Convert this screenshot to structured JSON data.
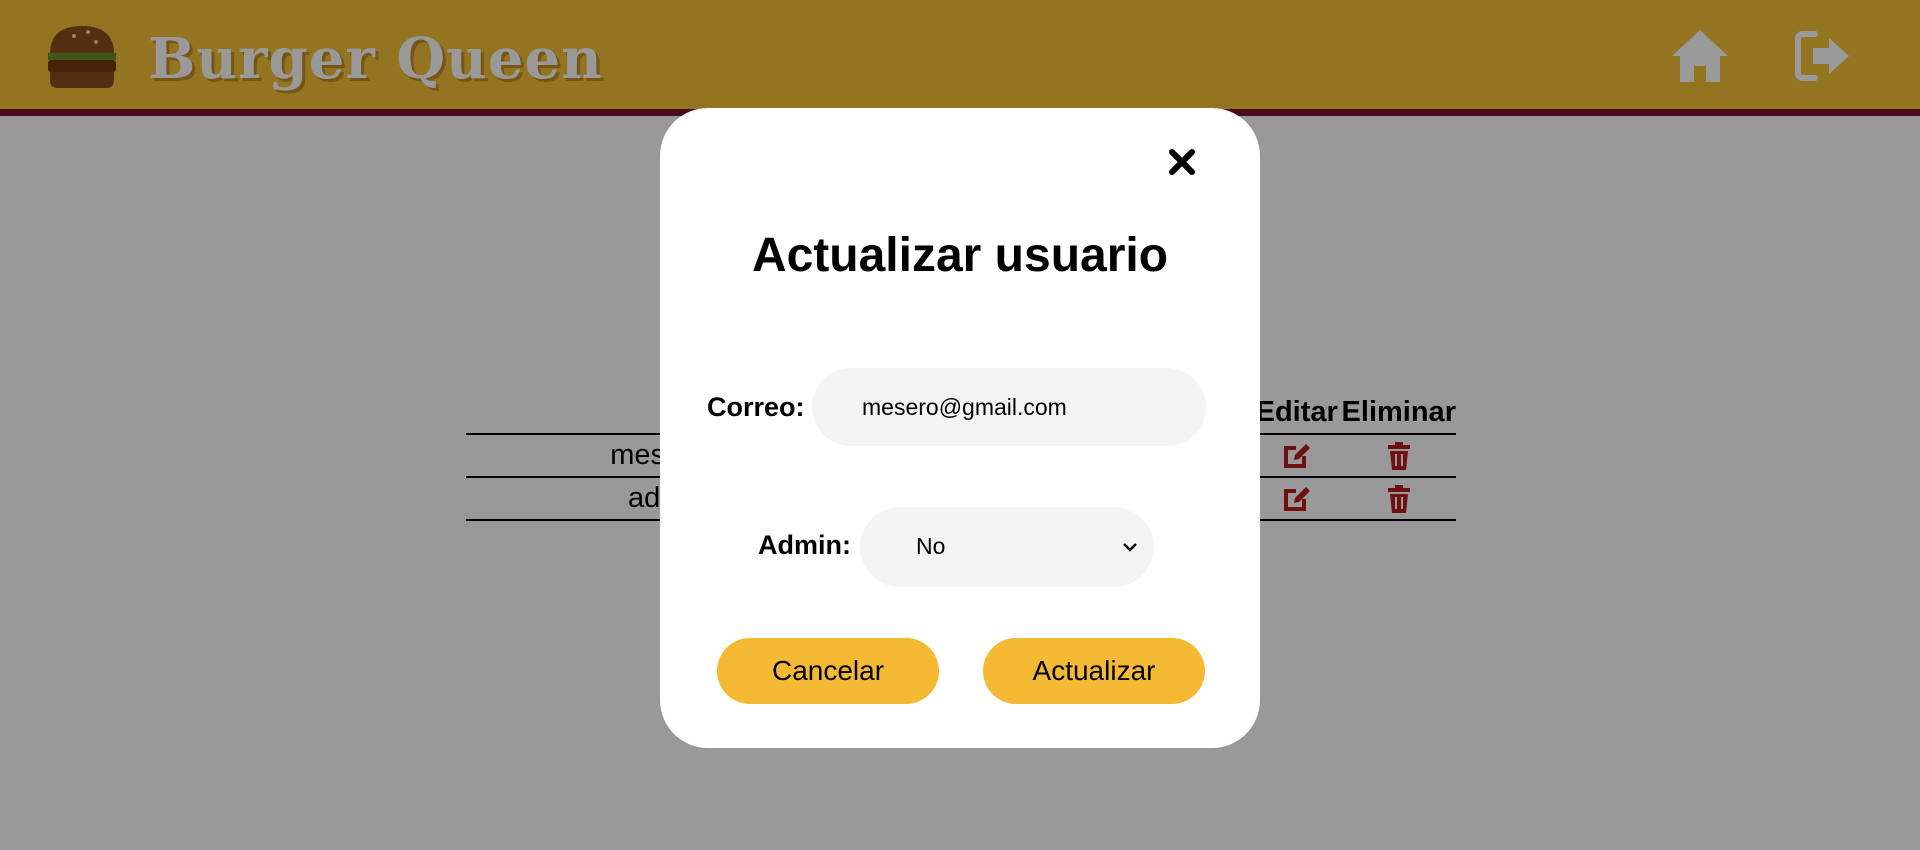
{
  "app": {
    "brand": "Burger Queen",
    "logo_text": "Burger Queen",
    "home_icon": "home-icon",
    "logout_icon": "logout-icon"
  },
  "table": {
    "headers": {
      "email": "Correo",
      "role": "",
      "edit": "Editar",
      "delete": "Eliminar"
    },
    "rows": [
      {
        "email": "mesero@gmail.com",
        "role": ""
      },
      {
        "email": "admin@localhost",
        "role": ""
      }
    ]
  },
  "modal": {
    "title": "Actualizar usuario",
    "close_icon": "close-icon",
    "email_label": "Correo:",
    "email_value": "mesero@gmail.com",
    "admin_label": "Admin:",
    "admin_value": "No",
    "cancel_label": "Cancelar",
    "update_label": "Actualizar"
  },
  "colors": {
    "header": "#f5c136",
    "header_border": "#7a1430",
    "button": "#f5b933",
    "icon_red": "#b71c1c",
    "overlay": "rgba(0,0,0,0.4)"
  }
}
